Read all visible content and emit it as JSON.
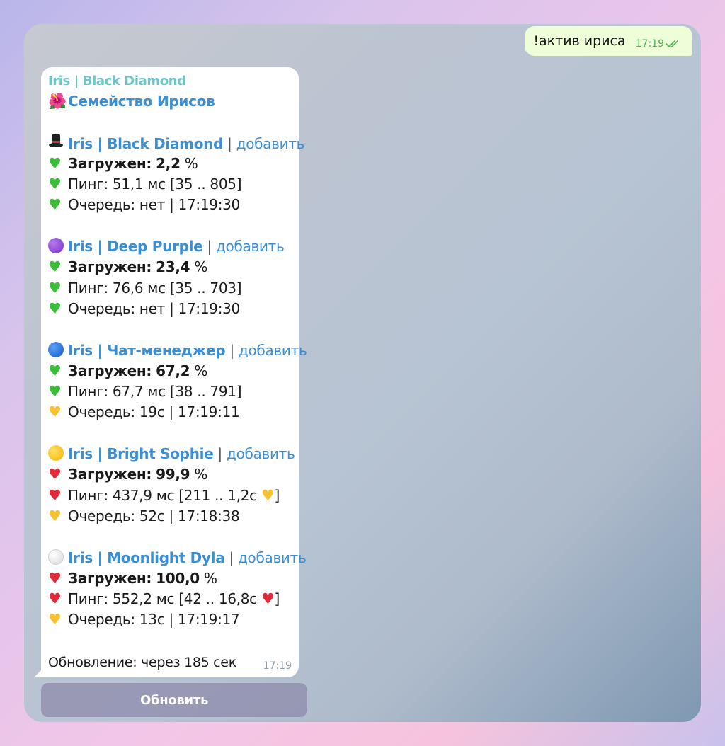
{
  "outgoing": {
    "text": "!актив ириса",
    "time": "17:19"
  },
  "incoming": {
    "sender": "Iris | Black Diamond",
    "title_emoji": "🌺",
    "title": "Семейство Ирисов",
    "add_label": "добавить",
    "sep": "|",
    "bots": [
      {
        "icon": "top-hat",
        "name": "Iris | Black Diamond",
        "load_label": "Загружен:",
        "load_value": "2,2",
        "load_unit": "%",
        "load_status": "green",
        "ping_text": "Пинг: 51,1 мс [35 .. 805]",
        "ping_status": "green",
        "queue_text": "Очередь: нет | 17:19:30",
        "queue_status": "green"
      },
      {
        "icon": "purple-circle",
        "name": "Iris | Deep Purple",
        "load_label": "Загружен:",
        "load_value": "23,4",
        "load_unit": "%",
        "load_status": "green",
        "ping_text": "Пинг: 76,6 мс [35 .. 703]",
        "ping_status": "green",
        "queue_text": "Очередь: нет | 17:19:30",
        "queue_status": "green"
      },
      {
        "icon": "blue-circle",
        "name": "Iris | Чат-менеджер",
        "load_label": "Загружен:",
        "load_value": "67,2",
        "load_unit": "%",
        "load_status": "green",
        "ping_text": "Пинг: 67,7 мс [38 .. 791]",
        "ping_status": "green",
        "queue_text": "Очередь: 19с | 17:19:11",
        "queue_status": "yellow"
      },
      {
        "icon": "yellow-circle",
        "name": "Iris | Bright Sophie",
        "load_label": "Загружен:",
        "load_value": "99,9",
        "load_unit": "%",
        "load_status": "broken",
        "ping_text": "Пинг: 437,9 мс [211 .. 1,2с",
        "ping_status": "broken",
        "ping_suffix_status": "yellow",
        "queue_text": "Очередь: 52с | 17:18:38",
        "queue_status": "yellow"
      },
      {
        "icon": "white-circle",
        "name": "Iris | Moonlight Dyla",
        "load_label": "Загружен:",
        "load_value": "100,0",
        "load_unit": "%",
        "load_status": "broken",
        "ping_text": "Пинг: 552,2 мс [42 .. 16,8с",
        "ping_status": "broken",
        "ping_suffix_status": "broken",
        "queue_text": "Очередь: 13с | 17:19:17",
        "queue_status": "yellow"
      }
    ],
    "footer": "Обновление: через 185 сек",
    "time": "17:19"
  },
  "inline_button": {
    "label": "Обновить"
  },
  "colors": {
    "link": "#3a8ed6",
    "sender": "#6dc4c9",
    "outgoing_bubble": "#eefed9",
    "read_ticks": "#4caf50",
    "button_bg": "#8c87aa"
  }
}
